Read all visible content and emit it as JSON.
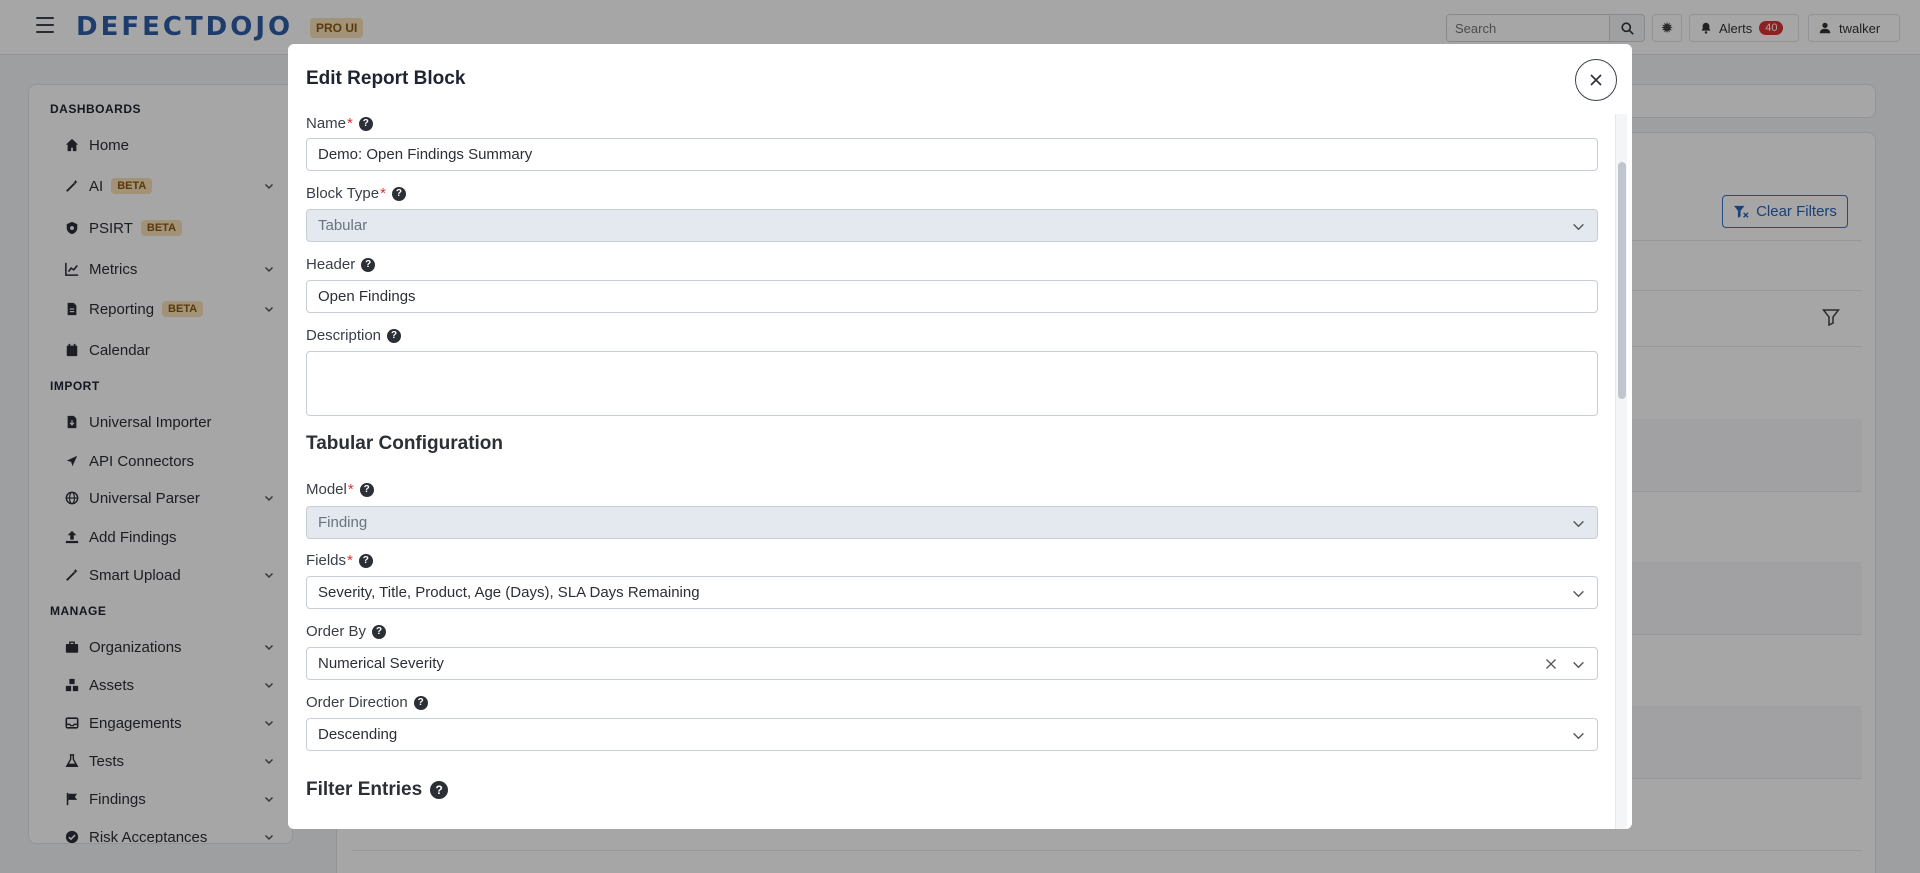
{
  "topbar": {
    "logo": "DEFECTDOJO",
    "pro_badge": "PRO UI",
    "search_placeholder": "Search",
    "alerts_label": "Alerts",
    "alerts_count": "40",
    "username": "twalker"
  },
  "sidebar": {
    "sections": {
      "dashboards": "DASHBOARDS",
      "import": "IMPORT",
      "manage": "MANAGE"
    },
    "items": [
      {
        "label": "Home",
        "icon": "home-icon"
      },
      {
        "label": "AI",
        "badge": "BETA",
        "icon": "magic-wand-icon"
      },
      {
        "label": "PSIRT",
        "badge": "BETA",
        "icon": "shield-icon"
      },
      {
        "label": "Metrics",
        "icon": "line-chart-icon"
      },
      {
        "label": "Reporting",
        "badge": "BETA",
        "icon": "report-file-icon"
      },
      {
        "label": "Calendar",
        "icon": "calendar-icon"
      },
      {
        "label": "Universal Importer",
        "icon": "file-import-icon"
      },
      {
        "label": "API Connectors",
        "icon": "plug-icon"
      },
      {
        "label": "Universal Parser",
        "icon": "globe-icon"
      },
      {
        "label": "Add Findings",
        "icon": "upload-icon"
      },
      {
        "label": "Smart Upload",
        "icon": "magic-wand-icon"
      },
      {
        "label": "Organizations",
        "icon": "briefcase-icon"
      },
      {
        "label": "Assets",
        "icon": "cubes-icon"
      },
      {
        "label": "Engagements",
        "icon": "inbox-icon"
      },
      {
        "label": "Tests",
        "icon": "flask-icon"
      },
      {
        "label": "Findings",
        "icon": "flag-icon"
      },
      {
        "label": "Risk Acceptances",
        "icon": "check-circle-icon"
      }
    ]
  },
  "main": {
    "clear_filters_label": "Clear Filters"
  },
  "modal": {
    "title": "Edit Report Block",
    "fields": {
      "name": {
        "label": "Name",
        "required": "*",
        "value": "Demo: Open Findings Summary"
      },
      "block_type": {
        "label": "Block Type",
        "required": "*",
        "value": "Tabular"
      },
      "header": {
        "label": "Header",
        "value": "Open Findings"
      },
      "description": {
        "label": "Description",
        "value": ""
      },
      "model": {
        "label": "Model",
        "required": "*",
        "value": "Finding"
      },
      "fields": {
        "label": "Fields",
        "required": "*",
        "value": "Severity, Title, Product, Age (Days), SLA Days Remaining"
      },
      "order_by": {
        "label": "Order By",
        "value": "Numerical Severity"
      },
      "order_direction": {
        "label": "Order Direction",
        "value": "Descending"
      }
    },
    "sections": {
      "tabular_config": "Tabular Configuration",
      "filter_entries": "Filter Entries"
    }
  }
}
